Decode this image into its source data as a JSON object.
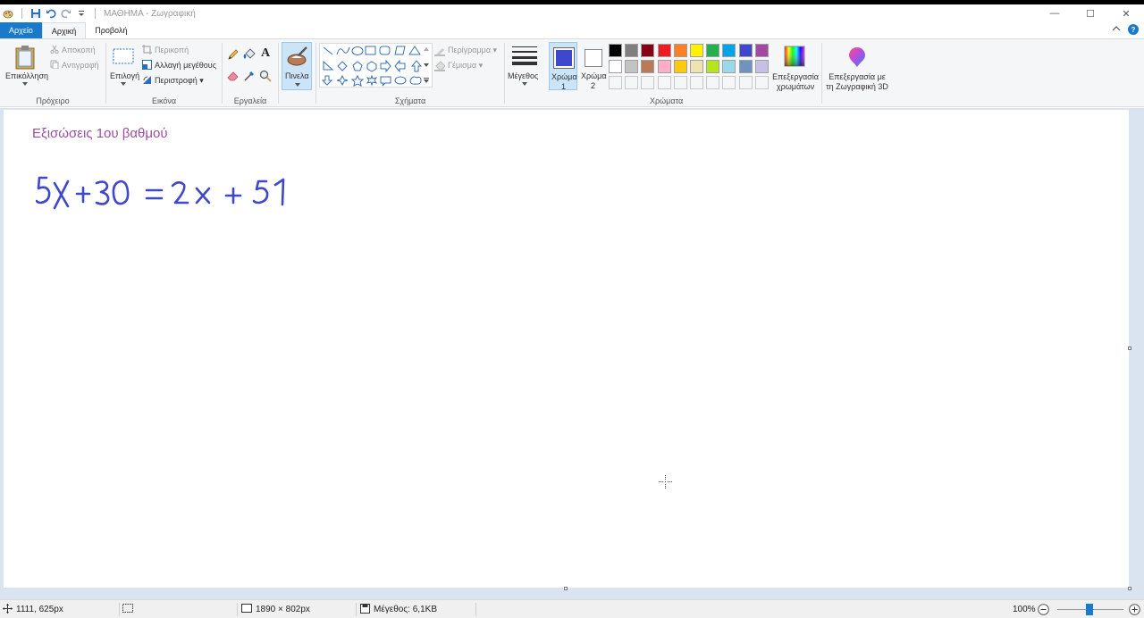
{
  "window": {
    "title": "ΜΑΘΗΜΑ - Ζωγραφική",
    "controls": {
      "minimize": "—",
      "maximize": "☐",
      "close": "✕"
    }
  },
  "tabs": [
    {
      "label": "Αρχείο"
    },
    {
      "label": "Αρχική"
    },
    {
      "label": "Προβολή"
    }
  ],
  "ribbon": {
    "clipboard": {
      "label": "Πρόχειρο",
      "paste": "Επικόλληση",
      "cut": "Αποκοπή",
      "copy": "Αντιγραφή"
    },
    "image": {
      "label": "Εικόνα",
      "select": "Επιλογή",
      "crop": "Περικοπή",
      "resize": "Αλλαγή μεγέθους",
      "rotate": "Περιστροφή"
    },
    "tools": {
      "label": "Εργαλεία"
    },
    "brushes": {
      "label": "Πινελα"
    },
    "shapes": {
      "label": "Σχήματα",
      "outline": "Περίγραμμα",
      "fill": "Γέμισμα"
    },
    "size": {
      "label": "Μέγεθος"
    },
    "color1": {
      "label": "Χρώμα",
      "sub": "1",
      "value": "#3f48cc"
    },
    "color2": {
      "label": "Χρώμα",
      "sub": "2",
      "value": "#ffffff"
    },
    "colors": {
      "label": "Χρώματα",
      "palette_row1": [
        "#000000",
        "#7f7f7f",
        "#880015",
        "#ed1c24",
        "#ff7f27",
        "#fff200",
        "#22b14c",
        "#00a2e8",
        "#3f48cc",
        "#a349a4"
      ],
      "palette_row2": [
        "#ffffff",
        "#c3c3c3",
        "#b97a57",
        "#ffaec9",
        "#ffc90e",
        "#efe4b0",
        "#b5e61d",
        "#99d9ea",
        "#7092be",
        "#c8bfe7"
      ],
      "edit_colors": "Επεξεργασία χρωμάτων"
    },
    "paint3d": {
      "label": "Επεξεργασία με τη Ζωγραφική 3D"
    }
  },
  "canvas": {
    "title": "Εξισώσεις 1ου βαθμού",
    "equation": "5x+30 = 2x + 51",
    "ink_color": "#3f48cc"
  },
  "status": {
    "cursor_pos": "1111, 625px",
    "image_size": "1890 × 802px",
    "file_size": "Μέγεθος: 6,1KB",
    "zoom": "100%"
  }
}
